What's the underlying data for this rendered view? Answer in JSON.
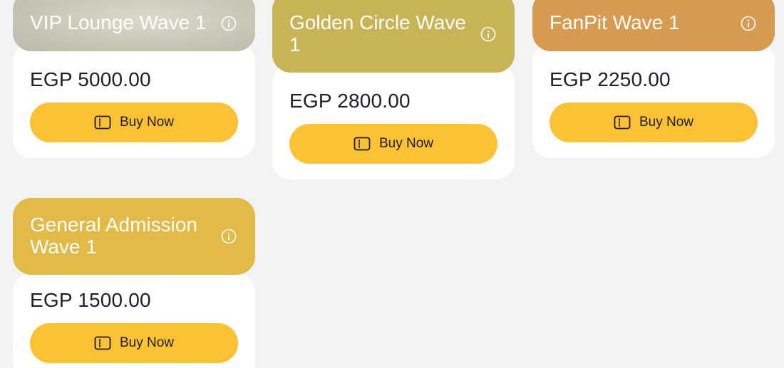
{
  "tickets": [
    {
      "name": "VIP Lounge Wave 1",
      "price": "EGP 5000.00",
      "button_label": "Buy Now"
    },
    {
      "name": "Golden Circle Wave 1",
      "price": "EGP 2800.00",
      "button_label": "Buy Now"
    },
    {
      "name": "FanPit Wave 1",
      "price": "EGP 2250.00",
      "button_label": "Buy Now"
    },
    {
      "name": "General Admission Wave 1",
      "price": "EGP 1500.00",
      "button_label": "Buy Now"
    }
  ],
  "icons": {
    "info": "info-icon",
    "ticket": "ticket-icon"
  },
  "colors": {
    "background": "#f3f2f5",
    "vip_header": "#c9c5b5",
    "golden_circle_header": "#c8b456",
    "fanpit_header": "#d69a50",
    "general_admission_header": "#e2ba47",
    "buy_button": "#fdc134",
    "card_body": "#ffffff"
  }
}
